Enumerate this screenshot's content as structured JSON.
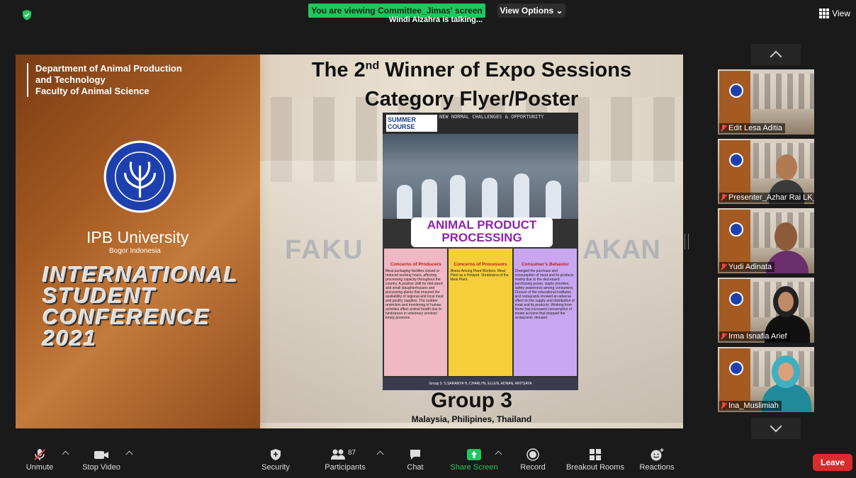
{
  "banner": {
    "viewing": "You are viewing Committee_Jimas' screen",
    "talking": "Windi Alzahra is talking...",
    "view_options": "View Options",
    "view": "View"
  },
  "slide": {
    "dept_lines": [
      "Department of Animal Production",
      "and Technology",
      "Faculty of Animal Science"
    ],
    "university": "IPB University",
    "university_sub": "Bogor Indonesia",
    "conference_lines": [
      "INTERNATIONAL",
      "STUDENT",
      "CONFERENCE",
      "2021"
    ],
    "title_prefix": "The 2",
    "title_sup": "nd",
    "title_suffix": " Winner of Expo Sessions",
    "title_line2": "Category Flyer/Poster",
    "group": "Group 3",
    "countries": "Malaysia, Philipines, Thailand",
    "bg_text_left": "FAKU",
    "bg_text_right": "AKAN"
  },
  "poster": {
    "summer": "SUMMER COURSE",
    "tagline": "NEW NORMAL CHALLENGES & OPPORTUNITY",
    "title_line1": "ANIMAL PRODUCT",
    "title_line2": "PROCESSING",
    "col1_head": "Concerns of Producers",
    "col1_text": "Meat packaging facilities closed or reduced working hours, affecting processing capacity throughout the country. A positive shift for mid-sized and small slaughterhouses and processing plants that ensured the availability of regional and local meat and poultry supplies. The sudden restriction and monitoring of human activities affect animal health due to hindrances in veterinary services' timely provision.",
    "col2_head": "Concerns of Processors",
    "col2_text": "Illness Among Plant Workers. Meat Plant as a Hotspot. Shutdowns of the Meat Plant.",
    "col3_head": "Consumer's Behavior",
    "col3_text": "Changed the purchase and consumption of meat and its products mainly due to the decreased purchasing power, staple priorities, safety awareness among consumers. Closure of the educational institutes and restaurants showed an adverse effect on the supply and distribution of meat and its products. Working from home has increased consumption of meats at home that dropped the restaurants' demand.",
    "footer": "Group 3: S.SARANYA H, CHARLYN, ELLEN, ADNAN, ARITSAYA"
  },
  "participants": [
    {
      "name": "Edit Lesa Aditia"
    },
    {
      "name": "Presenter_Azhar Rai LK_I..."
    },
    {
      "name": "Yudi Adinata"
    },
    {
      "name": "Irma Isnafia Arief"
    },
    {
      "name": "Ina_Muslimiah"
    }
  ],
  "toolbar": {
    "unmute": "Unmute",
    "stop_video": "Stop Video",
    "security": "Security",
    "participants": "Participants",
    "participants_count": "87",
    "chat": "Chat",
    "share_screen": "Share Screen",
    "record": "Record",
    "breakout": "Breakout Rooms",
    "reactions": "Reactions",
    "leave": "Leave"
  },
  "colors": {
    "accent_green": "#22c55e",
    "leave_red": "#d92c2c"
  }
}
